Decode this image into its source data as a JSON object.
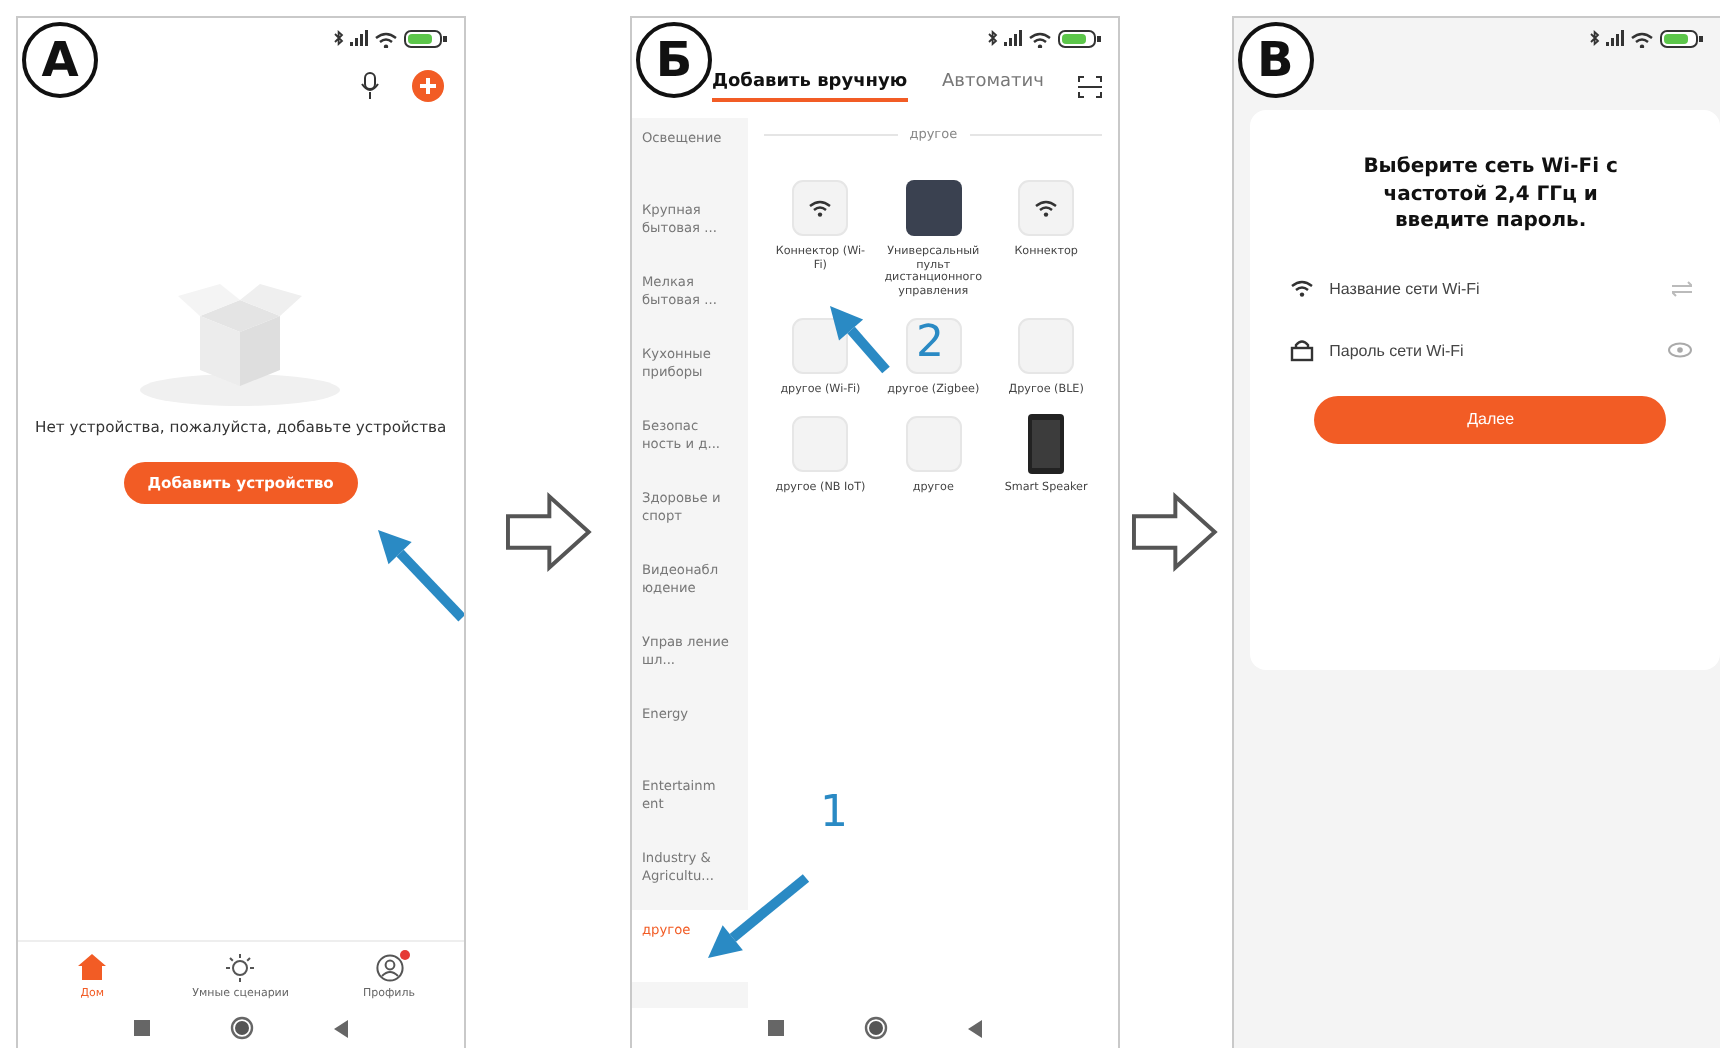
{
  "panels": [
    {
      "kind": "home",
      "label": "А",
      "empty_message": "Нет устройства, пожалуйста, добавьте устройства",
      "add_button": "Добавить устройство",
      "nav": [
        {
          "label": "Дом",
          "kind": "house",
          "selected": true,
          "badge": false
        },
        {
          "label": "Умные сценарии",
          "kind": "sun",
          "selected": false,
          "badge": false
        },
        {
          "label": "Профиль",
          "kind": "person",
          "selected": false,
          "badge": true
        }
      ]
    },
    {
      "kind": "catalog",
      "label": "Б",
      "tabs": [
        {
          "label": "Добавить вручную",
          "selected": true
        },
        {
          "label": "Автоматич",
          "selected": false
        }
      ],
      "categories": [
        {
          "label": "Освещение",
          "selected": false
        },
        {
          "label": "Крупная бытовая ...",
          "selected": false
        },
        {
          "label": "Мелкая бытовая ...",
          "selected": false
        },
        {
          "label": "Кухонные приборы",
          "selected": false
        },
        {
          "label": "Безопас ность и д...",
          "selected": false
        },
        {
          "label": "Здоровье и спорт",
          "selected": false
        },
        {
          "label": "Видеонабл юдение",
          "selected": false
        },
        {
          "label": "Управ ление шл...",
          "selected": false
        },
        {
          "label": "Energy",
          "selected": false
        },
        {
          "label": "Entertainm ent",
          "selected": false
        },
        {
          "label": "Industry & Agricultu...",
          "selected": false
        },
        {
          "label": "другое",
          "selected": true
        }
      ],
      "section_title": "другое",
      "devices": [
        {
          "name": "Коннектор (Wi-Fi)",
          "kind": "wifi"
        },
        {
          "name": "Универсальный пульт дистанционного управления",
          "kind": "remote"
        },
        {
          "name": "Коннектор",
          "kind": "wifi"
        },
        {
          "name": "другое (Wi-Fi)",
          "kind": "plain"
        },
        {
          "name": "другое (Zigbee)",
          "kind": "plain"
        },
        {
          "name": "Другое (BLE)",
          "kind": "plain"
        },
        {
          "name": "другое (NB IoT)",
          "kind": "plain"
        },
        {
          "name": "другое",
          "kind": "plain"
        },
        {
          "name": "Smart Speaker",
          "kind": "speaker"
        }
      ],
      "callouts": [
        {
          "text": "2",
          "kind": "device"
        },
        {
          "text": "1",
          "kind": "category"
        }
      ]
    },
    {
      "kind": "wifi",
      "label": "В",
      "title": "Выберите сеть Wi-Fi с частотой 2,4 ГГц и введите пароль.",
      "fields": [
        {
          "kind": "network",
          "placeholder": "Название сети Wi-Fi"
        },
        {
          "kind": "password",
          "placeholder": "Пароль сети Wi-Fi"
        }
      ],
      "button": "Далее"
    }
  ]
}
